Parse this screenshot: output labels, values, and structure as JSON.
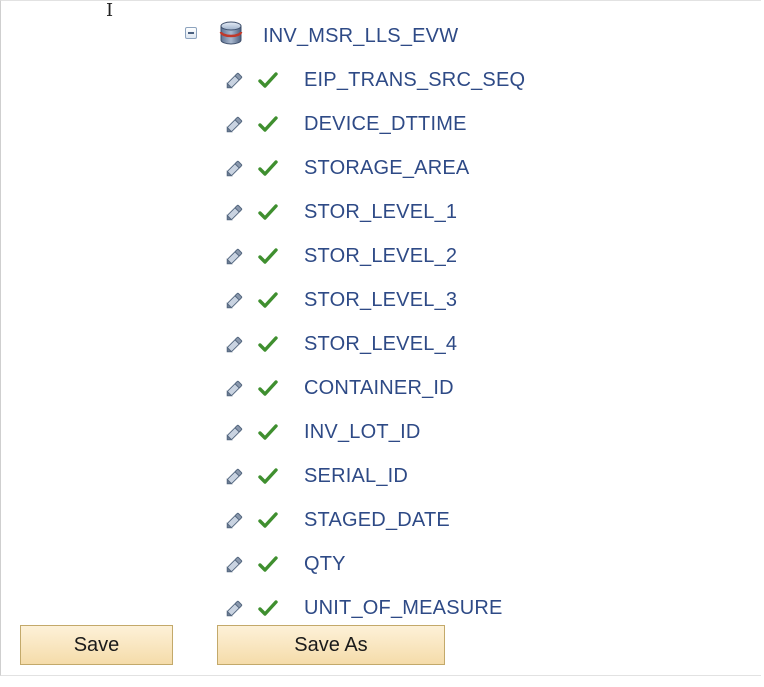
{
  "tree": {
    "root": {
      "label": "INV_MSR_LLS_EVW",
      "icon": "database-icon",
      "expanded": true
    },
    "fields": [
      {
        "label": "EIP_TRANS_SRC_SEQ",
        "icons": [
          "pencil-icon",
          "checkmark-icon"
        ]
      },
      {
        "label": "DEVICE_DTTIME",
        "icons": [
          "pencil-icon",
          "checkmark-icon"
        ]
      },
      {
        "label": "STORAGE_AREA",
        "icons": [
          "pencil-icon",
          "checkmark-icon"
        ]
      },
      {
        "label": "STOR_LEVEL_1",
        "icons": [
          "pencil-icon",
          "checkmark-icon"
        ]
      },
      {
        "label": "STOR_LEVEL_2",
        "icons": [
          "pencil-icon",
          "checkmark-icon"
        ]
      },
      {
        "label": "STOR_LEVEL_3",
        "icons": [
          "pencil-icon",
          "checkmark-icon"
        ]
      },
      {
        "label": "STOR_LEVEL_4",
        "icons": [
          "pencil-icon",
          "checkmark-icon"
        ]
      },
      {
        "label": "CONTAINER_ID",
        "icons": [
          "pencil-icon",
          "checkmark-icon"
        ]
      },
      {
        "label": "INV_LOT_ID",
        "icons": [
          "pencil-icon",
          "checkmark-icon"
        ]
      },
      {
        "label": "SERIAL_ID",
        "icons": [
          "pencil-icon",
          "checkmark-icon"
        ]
      },
      {
        "label": "STAGED_DATE",
        "icons": [
          "pencil-icon",
          "checkmark-icon"
        ]
      },
      {
        "label": "QTY",
        "icons": [
          "pencil-icon",
          "checkmark-icon"
        ]
      },
      {
        "label": "UNIT_OF_MEASURE",
        "icons": [
          "pencil-icon",
          "checkmark-icon"
        ]
      }
    ]
  },
  "buttons": {
    "save_label": "Save",
    "save_as_label": "Save As"
  },
  "colors": {
    "link_text": "#2e4a86",
    "check_green": "#3f8f2f",
    "button_fill": "#f8e4bc",
    "button_border": "#c3a96a"
  }
}
